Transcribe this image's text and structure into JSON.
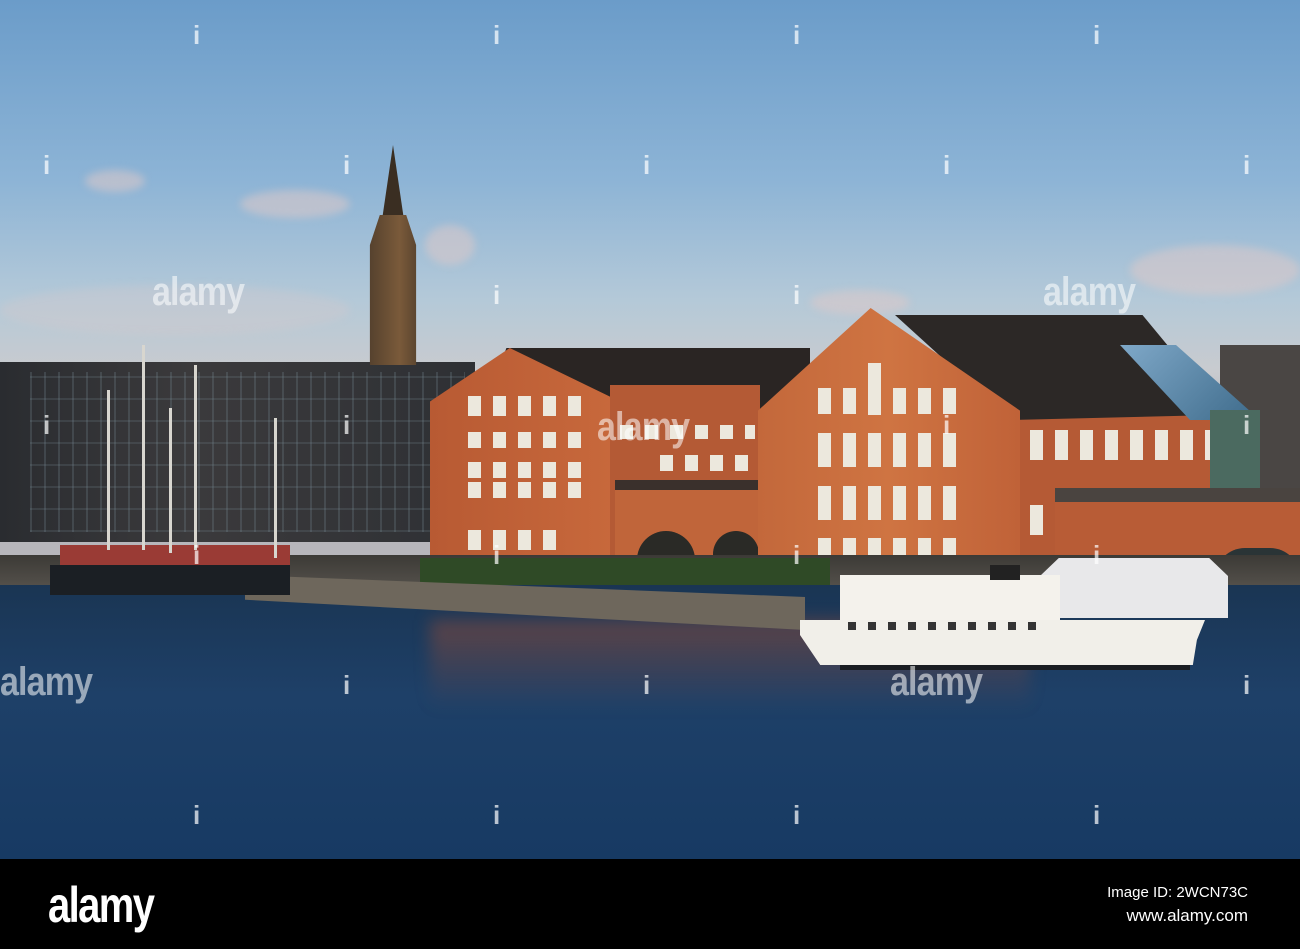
{
  "watermark": {
    "text": "alamy",
    "mark": "i"
  },
  "footer": {
    "logo": "alamy",
    "image_id": "Image ID: 2WCN73C",
    "url": "www.alamy.com"
  }
}
